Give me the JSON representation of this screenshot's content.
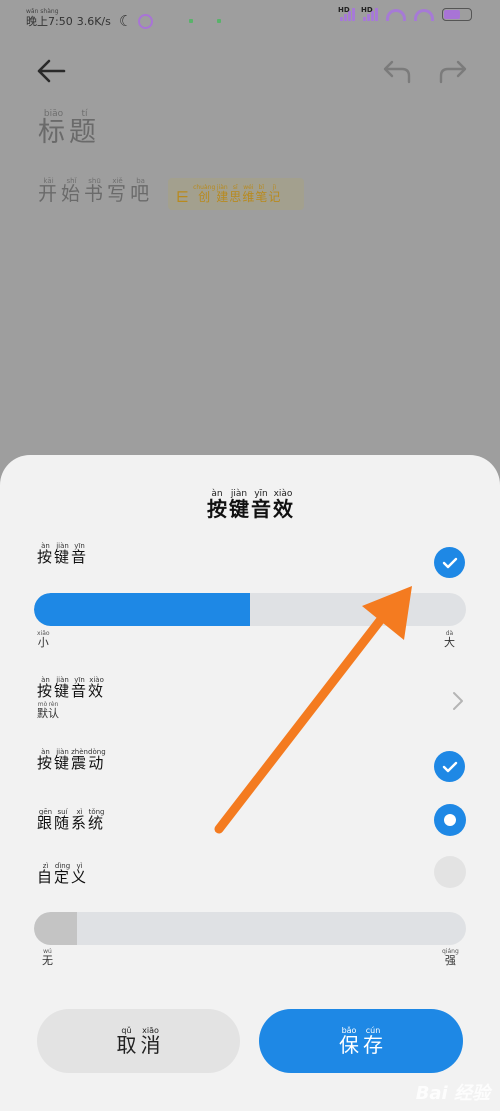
{
  "status_bar": {
    "time_pinyin": "wǎn shàng",
    "time": "晚上7:50",
    "net_speed": "3.6K/s",
    "hd1": "HD",
    "hd2": "HD",
    "battery_level": 0.6
  },
  "editor": {
    "title": [
      {
        "py": "biāo",
        "ch": "标"
      },
      {
        "py": "tí",
        "ch": "题"
      }
    ],
    "hint": [
      {
        "py": "kāi",
        "ch": "开"
      },
      {
        "py": "shǐ",
        "ch": "始"
      },
      {
        "py": "shū",
        "ch": "书"
      },
      {
        "py": "xiě",
        "ch": "写"
      },
      {
        "py": "ba",
        "ch": "吧"
      }
    ],
    "mindmap_chip": [
      {
        "py": "chuàng",
        "ch": "创"
      },
      {
        "py": "jiàn",
        "ch": "建"
      },
      {
        "py": "sī",
        "ch": "思"
      },
      {
        "py": "wéi",
        "ch": "维"
      },
      {
        "py": "bǐ",
        "ch": "笔"
      },
      {
        "py": "jì",
        "ch": "记"
      }
    ]
  },
  "sheet": {
    "title": [
      {
        "py": "àn",
        "ch": "按"
      },
      {
        "py": "jiàn",
        "ch": "键"
      },
      {
        "py": "yīn",
        "ch": "音"
      },
      {
        "py": "xiào",
        "ch": "效"
      }
    ],
    "key_sound": {
      "label": [
        {
          "py": "àn",
          "ch": "按"
        },
        {
          "py": "jiàn",
          "ch": "键"
        },
        {
          "py": "yīn",
          "ch": "音"
        }
      ],
      "checked": true
    },
    "volume": {
      "level": 0.5,
      "min_label": {
        "py": "xiǎo",
        "ch": "小"
      },
      "max_label": {
        "py": "dà",
        "ch": "大"
      }
    },
    "key_sound_effect": {
      "label": [
        {
          "py": "àn",
          "ch": "按"
        },
        {
          "py": "jiàn",
          "ch": "键"
        },
        {
          "py": "yīn",
          "ch": "音"
        },
        {
          "py": "xiào",
          "ch": "效"
        }
      ],
      "value": [
        {
          "py": "mò",
          "ch": "默"
        },
        {
          "py": "rèn",
          "ch": "认"
        }
      ]
    },
    "key_vibration": {
      "label": [
        {
          "py": "àn",
          "ch": "按"
        },
        {
          "py": "jiàn",
          "ch": "键"
        },
        {
          "py": "zhèn",
          "ch": "震"
        },
        {
          "py": "dòng",
          "ch": "动"
        }
      ],
      "checked": true
    },
    "follow_system": {
      "label": [
        {
          "py": "gēn",
          "ch": "跟"
        },
        {
          "py": "suí",
          "ch": "随"
        },
        {
          "py": "xì",
          "ch": "系"
        },
        {
          "py": "tǒng",
          "ch": "统"
        }
      ],
      "selected": true
    },
    "custom": {
      "label": [
        {
          "py": "zì",
          "ch": "自"
        },
        {
          "py": "dìng",
          "ch": "定"
        },
        {
          "py": "yì",
          "ch": "义"
        }
      ],
      "selected": false
    },
    "vibration": {
      "level": 0.1,
      "min_label": {
        "py": "wú",
        "ch": "无"
      },
      "max_label": {
        "py": "qiáng",
        "ch": "强"
      }
    },
    "cancel_button": [
      {
        "py": "qǔ",
        "ch": "取"
      },
      {
        "py": "xiāo",
        "ch": "消"
      }
    ],
    "save_button": [
      {
        "py": "bǎo",
        "ch": "保"
      },
      {
        "py": "cún",
        "ch": "存"
      }
    ]
  },
  "watermark": "Bai 经验",
  "colors": {
    "accent": "#1e88e5",
    "arrow": "#f47b20",
    "dim_background": "#9e9e9e",
    "sheet_background": "#f2f2f2",
    "vibration_fill": "#c4c4c4"
  }
}
